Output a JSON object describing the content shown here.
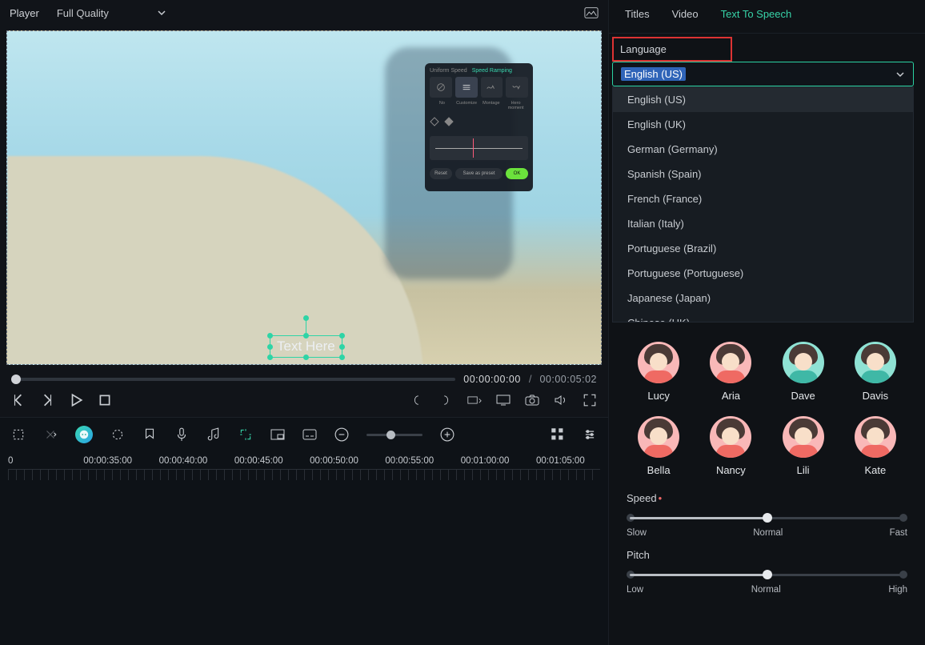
{
  "topbar": {
    "title": "Player",
    "quality": "Full Quality"
  },
  "preview": {
    "text_placeholder": "Text Here",
    "overlay": {
      "tab_a": "Uniform Speed",
      "tab_b": "Speed Ramping",
      "labels": [
        "No",
        "Customize",
        "Montage",
        "Hero moment"
      ],
      "reset": "Reset",
      "save": "Save as preset",
      "ok": "OK"
    }
  },
  "transport": {
    "current": "00:00:00:00",
    "sep": "/",
    "duration": "00:00:05:02"
  },
  "timeline": {
    "labels": [
      "0",
      "00:00:35:00",
      "00:00:40:00",
      "00:00:45:00",
      "00:00:50:00",
      "00:00:55:00",
      "00:01:00:00",
      "00:01:05:00"
    ]
  },
  "tabs": {
    "titles": "Titles",
    "video": "Video",
    "tts": "Text To Speech"
  },
  "language": {
    "label": "Language",
    "selected": "English (US)",
    "options": [
      "English (US)",
      "English (UK)",
      "German (Germany)",
      "Spanish (Spain)",
      "French (France)",
      "Italian (Italy)",
      "Portuguese (Brazil)",
      "Portuguese (Portuguese)",
      "Japanese (Japan)",
      "Chinese (HK)"
    ]
  },
  "voices": [
    {
      "name": "Lucy",
      "bg": "pink",
      "body": "red"
    },
    {
      "name": "Aria",
      "bg": "pink",
      "body": "red"
    },
    {
      "name": "Dave",
      "bg": "teal",
      "body": "teal"
    },
    {
      "name": "Davis",
      "bg": "teal",
      "body": "teal"
    },
    {
      "name": "Bella",
      "bg": "pink",
      "body": "red"
    },
    {
      "name": "Nancy",
      "bg": "pink",
      "body": "red"
    },
    {
      "name": "Lili",
      "bg": "pink",
      "body": "red"
    },
    {
      "name": "Kate",
      "bg": "pink",
      "body": "red"
    }
  ],
  "speed": {
    "label": "Speed",
    "marks": [
      "Slow",
      "Normal",
      "Fast"
    ],
    "value_pct": 50
  },
  "pitch": {
    "label": "Pitch",
    "marks": [
      "Low",
      "Normal",
      "High"
    ],
    "value_pct": 50
  }
}
